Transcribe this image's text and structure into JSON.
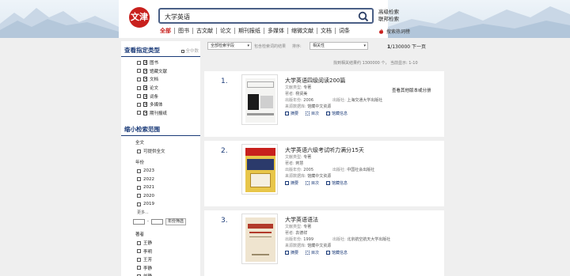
{
  "header": {
    "logo_text": "文津",
    "search_value": "大学英语",
    "advanced_search": "高级检索",
    "federated_search": "联邦检索",
    "categories": [
      "全部",
      "图书",
      "古文献",
      "论文",
      "期刊报纸",
      "多媒体",
      "缩微文献",
      "文档",
      "词条"
    ],
    "hot_search": "搜索热词榜"
  },
  "sidebar": {
    "type_title": "查看指定类型",
    "select_all": "全中数",
    "types": [
      "图书",
      "馆藏文献",
      "文档",
      "论文",
      "词条",
      "多媒体",
      "期刊报纸"
    ],
    "narrow_title": "缩小检索范围",
    "fulltext_label": "全文",
    "fulltext_option": "可提供全文",
    "year_label": "年份",
    "years": [
      "2023",
      "2022",
      "2021",
      "2020",
      "2019"
    ],
    "more_label": "更多...",
    "range_button": "年份筛选",
    "author_label": "著者",
    "authors": [
      "王静",
      "李明",
      "王芳",
      "李静",
      "刘静"
    ]
  },
  "controls": {
    "field_select": "全部检索字段",
    "within_label": "包含检索词的结果",
    "sort_label": "排序:",
    "sort_select": "相关性",
    "page_current": "1",
    "page_total": "/130000",
    "next_page": "下一页",
    "stats": "找到相关结果约 1300000 个，  当前显示: 1-10"
  },
  "results": [
    {
      "num": "1.",
      "title": "大学英语四级阅读200篇",
      "type_label": "文献类型:",
      "type_value": "专著",
      "author_label": "著者:",
      "author_value": "杨贤美",
      "year_label": "出版年份:",
      "year_value": "2006",
      "pub_label": "出版社:",
      "pub_value": "上海交通大学出版社",
      "db_label": "来源数据库:",
      "db_value": "馆藏中文资源",
      "holding": "查看其他版本或分册",
      "actions": [
        "摘要",
        "目次",
        "馆藏信息"
      ]
    },
    {
      "num": "2.",
      "title": "大学英语六级考试听力满分15天",
      "type_label": "文献类型:",
      "type_value": "专著",
      "author_label": "著者:",
      "author_value": "蒋慧",
      "year_label": "出版年份:",
      "year_value": "2005",
      "pub_label": "出版社:",
      "pub_value": "中国社会出版社",
      "db_label": "来源数据库:",
      "db_value": "馆藏中文资源",
      "holding": "",
      "actions": [
        "摘要",
        "目次",
        "馆藏信息"
      ]
    },
    {
      "num": "3.",
      "title": "大学英语语法",
      "type_label": "文献类型:",
      "type_value": "专著",
      "author_label": "著者:",
      "author_value": "袁德祥",
      "year_label": "出版年份:",
      "year_value": "1999",
      "pub_label": "出版社:",
      "pub_value": "北京航空航天大学出版社",
      "db_label": "来源数据库:",
      "db_value": "馆藏中文资源",
      "holding": "",
      "actions": [
        "摘要",
        "目次",
        "馆藏信息"
      ]
    }
  ]
}
